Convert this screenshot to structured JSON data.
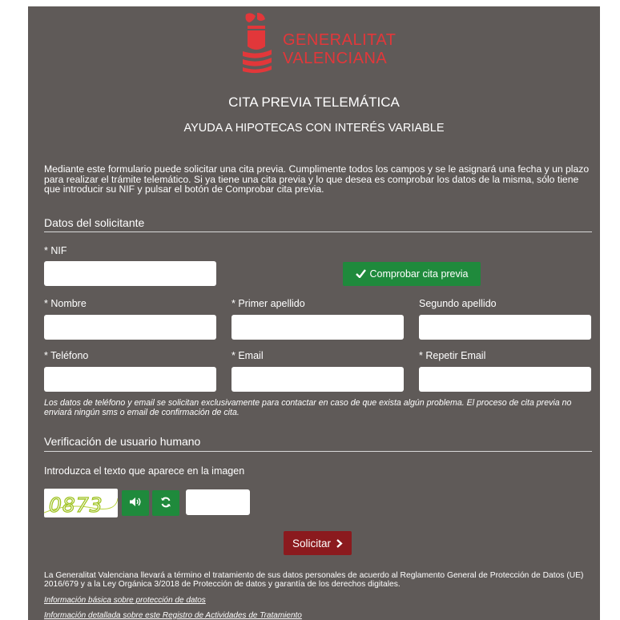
{
  "header": {
    "logo_line1": "GENERALITAT",
    "logo_line2": "VALENCIANA",
    "brand_color": "#e2373a",
    "title": "CITA PREVIA TELEMÁTICA",
    "subtitle": "AYUDA A HIPOTECAS CON INTERÉS VARIABLE"
  },
  "intro": "Mediante este formulario puede solicitar una cita previa. Cumplimente todos los campos y se le asignará una fecha y un plazo para realizar el trámite telemático. Si ya tiene una cita previa y lo que desea es comprobar los datos de la misma, sólo tiene que introducir su NIF y pulsar el botón de Comprobar cita previa.",
  "applicant": {
    "section_title": "Datos del solicitante",
    "nif_label": "* NIF",
    "nif_value": "",
    "check_button_label": "Comprobar cita previa",
    "nombre_label": "* Nombre",
    "nombre_value": "",
    "apellido1_label": "* Primer apellido",
    "apellido1_value": "",
    "apellido2_label": "Segundo apellido",
    "apellido2_value": "",
    "telefono_label": "* Teléfono",
    "telefono_value": "",
    "email_label": "* Email",
    "email_value": "",
    "email_repeat_label": "* Repetir Email",
    "email_repeat_value": "",
    "note": "Los datos de teléfono y email se solicitan exclusivamente para contactar en caso de que exista algún problema. El proceso de cita previa no enviará ningún sms o email de confirmación de cita."
  },
  "verification": {
    "section_title": "Verificación de usuario humano",
    "instruction": "Introduzca el texto que aparece en la imagen",
    "captcha_text": "0873",
    "audio_icon": "speaker-icon",
    "refresh_icon": "refresh-icon",
    "captcha_input_value": ""
  },
  "submit": {
    "label": "Solicitar",
    "icon": "chevron-right-icon",
    "color": "#8b1a1e"
  },
  "footer": {
    "text": "La Generalitat Valenciana llevará a término el tratamiento de sus datos personales de acuerdo al Reglamento General de Protección de Datos (UE) 2016/679 y a la Ley Orgánica 3/2018 de Protección de datos y garantía de los derechos digitales.",
    "link1": "Información básica sobre protección de datos",
    "link2": "Información detallada sobre este Registro de Actividades de Tratamiento"
  },
  "colors": {
    "panel_bg": "#5f5a58",
    "green_button": "#1f8a3c"
  }
}
